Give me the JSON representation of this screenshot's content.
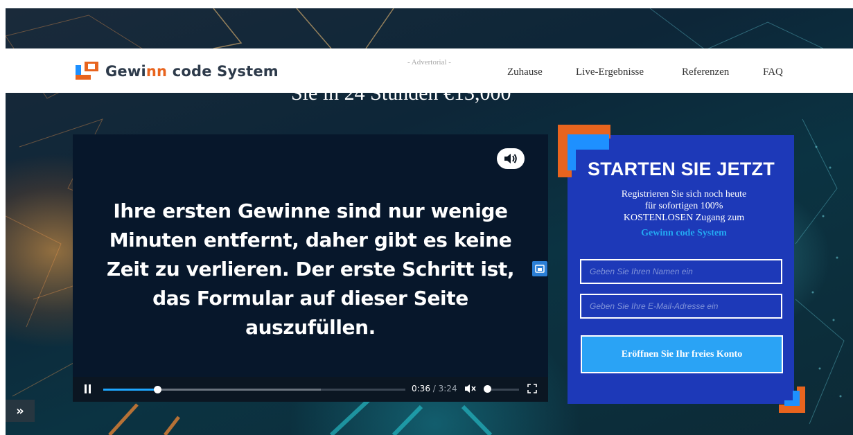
{
  "header": {
    "brand_part1": "Gewi",
    "brand_accent": "nn",
    "brand_part2": " code System",
    "advertorial": "- Advertorial -",
    "nav": [
      "Zuhause",
      "Live-Ergebnisse",
      "Referenzen",
      "FAQ"
    ]
  },
  "hero": {
    "headline_visible": "Sie in 24 Stunden €13,000"
  },
  "video": {
    "caption": "Ihre ersten Gewinne sind nur wenige Minuten entfernt, daher gibt es keine Zeit zu verlieren. Der erste Schritt ist, das Formular auf dieser Seite auszufüllen.",
    "current_time": "0:36",
    "separator": " / ",
    "duration": "3:24",
    "sound_icon": "speaker-on-icon",
    "playback_progress": 0.18,
    "buffered_progress": 0.72,
    "volume_level": 0.05
  },
  "signup": {
    "title": "STARTEN SIE JETZT",
    "subtitle_line1": "Registrieren Sie sich noch heute",
    "subtitle_line2": "für sofortigen 100%",
    "subtitle_line3": "KOSTENLOSEN Zugang zum",
    "brand": "Gewinn code System",
    "name_placeholder": "Geben Sie Ihren Namen ein",
    "email_placeholder": "Geben Sie Ihre E-Mail-Adresse ein",
    "cta_label": "Eröffnen Sie Ihr freies Konto"
  },
  "fab": {
    "label": "»"
  },
  "colors": {
    "panel": "#1d39b8",
    "cta": "#2aa3f5",
    "brand_orange": "#e8641e",
    "brand_blue": "#1e90ff",
    "video_bg": "#07172b"
  }
}
